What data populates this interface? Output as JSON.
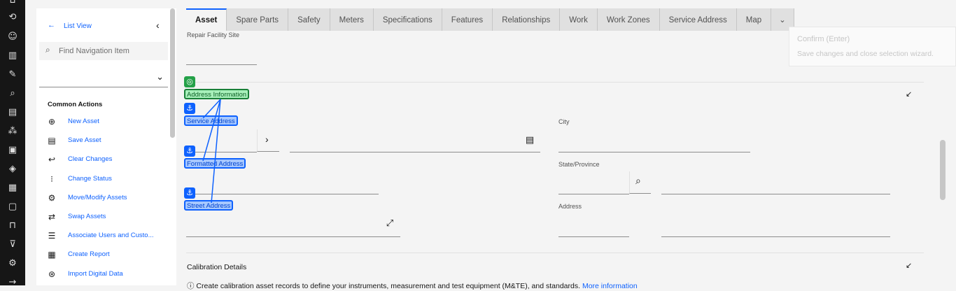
{
  "nav": {
    "back_label": "List View",
    "search_placeholder": "Find Navigation Item",
    "section_title": "Common Actions",
    "actions": [
      {
        "label": "New Asset",
        "icon": "add-circle-icon"
      },
      {
        "label": "Save Asset",
        "icon": "save-icon"
      },
      {
        "label": "Clear Changes",
        "icon": "undo-icon"
      },
      {
        "label": "Change Status",
        "icon": "status-icon"
      },
      {
        "label": "Move/Modify Assets",
        "icon": "move-icon"
      },
      {
        "label": "Swap Assets",
        "icon": "swap-icon"
      },
      {
        "label": "Associate Users and Custo...",
        "icon": "users-icon"
      },
      {
        "label": "Create Report",
        "icon": "report-icon"
      },
      {
        "label": "Import Digital Data",
        "icon": "import-icon"
      }
    ]
  },
  "tabs": [
    "Asset",
    "Spare Parts",
    "Safety",
    "Meters",
    "Specifications",
    "Features",
    "Relationships",
    "Work",
    "Work Zones",
    "Service Address",
    "Map"
  ],
  "tabs_more": "⌄",
  "tooltip": {
    "title": "Confirm (Enter)",
    "text": "Save changes and close selection wizard."
  },
  "form": {
    "repair_facility_label": "Repair Facility Site",
    "address_section": "Address Information",
    "service_address": "Service Address",
    "formatted_address": "Formatted Address",
    "street_address": "Street Address",
    "city": "City",
    "state": "State/Province",
    "address": "Address",
    "calibration_section": "Calibration Details",
    "calibration_note": "Create calibration asset records to define your instruments, measurement and test equipment (M&TE), and standards.",
    "more_info": "More information"
  },
  "colors": {
    "accent": "#0f62fe",
    "green": "#24a148",
    "rail": "#161616"
  }
}
